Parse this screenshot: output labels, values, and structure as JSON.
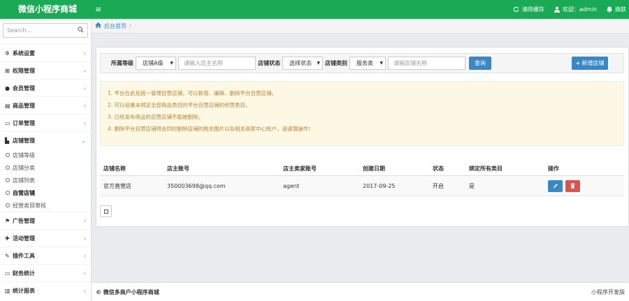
{
  "topbar": {
    "brand": "微信小程序商城",
    "clear_cache": "清除缓存",
    "welcome": "欢迎：admin",
    "skin": "换肤",
    "accent_color": "#1aaa55"
  },
  "sidebar": {
    "search_placeholder": "Search...",
    "items": [
      {
        "label": "系统设置",
        "icon": "gear-icon"
      },
      {
        "label": "权限管理",
        "icon": "sitemap-icon"
      },
      {
        "label": "会员管理",
        "icon": "user-icon"
      },
      {
        "label": "商品管理",
        "icon": "list-icon"
      },
      {
        "label": "订单管理",
        "icon": "credit-card-icon"
      },
      {
        "label": "店铺管理",
        "icon": "store-icon"
      },
      {
        "label": "广告管理",
        "icon": "flag-icon"
      },
      {
        "label": "活动管理",
        "icon": "plus-icon"
      },
      {
        "label": "插件工具",
        "icon": "plug-icon"
      },
      {
        "label": "财务统计",
        "icon": "wallet-icon"
      },
      {
        "label": "统计报表",
        "icon": "chart-icon"
      }
    ],
    "store_subitems": [
      {
        "label": "店铺等级"
      },
      {
        "label": "店铺分类"
      },
      {
        "label": "店铺列表"
      },
      {
        "label": "自营店铺"
      },
      {
        "label": "经营类目审核"
      }
    ]
  },
  "breadcrumb": {
    "home": "后台首页",
    "separator": "/"
  },
  "filter": {
    "level_label": "所属等级",
    "level_value": "店铺A级",
    "name_placeholder": "请输入店主名称",
    "status_label": "店铺状态",
    "status_value": "选择状态",
    "type_label": "店铺类别",
    "type_value": "服务类",
    "store_placeholder": "请输店铺名称",
    "query_button": "查询",
    "add_button": "新增店铺"
  },
  "notice": [
    "1. 平台在此处统一管理自营店铺，可以新增、编辑、删除平台自营店铺。",
    "2. 可以设置未绑定全部商品类目的平台自营店铺的经营类目。",
    "3. 已经发布商品的自营店铺不能被删除。",
    "4. 删除平台自营店铺将会同时删除店铺的相关图片以及相关商家中心账户，请谨慎操作！"
  ],
  "table": {
    "headers": [
      "店铺名称",
      "店主账号",
      "店主卖家账号",
      "创建日期",
      "状态",
      "绑定所有类目",
      "操作"
    ],
    "rows": [
      [
        "官方直营店",
        "350003698@qq.com",
        "agent",
        "2017-09-25",
        "开启",
        "是"
      ]
    ]
  },
  "footer": {
    "copyright": "© 微信多商户小程序商城",
    "right_text": "小程序开发版"
  }
}
